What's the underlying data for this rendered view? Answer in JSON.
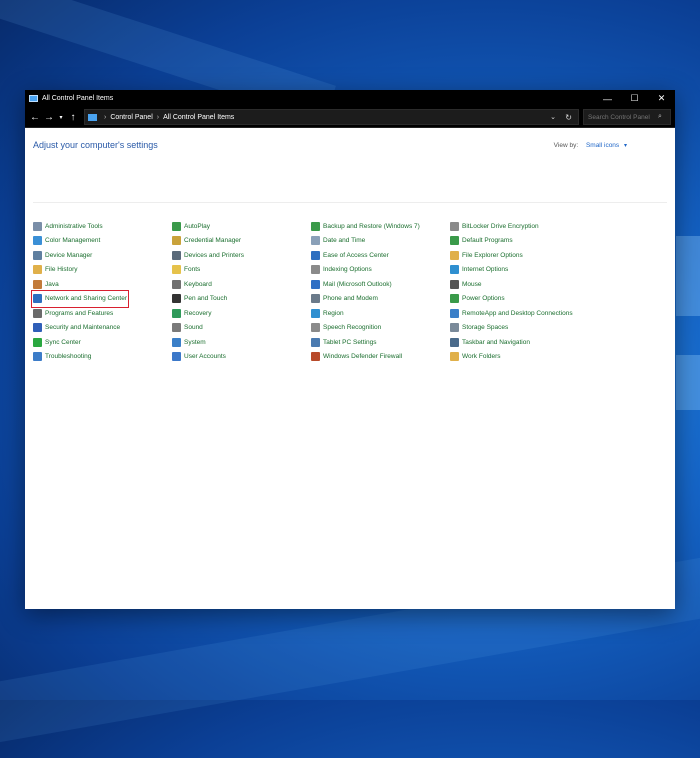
{
  "window": {
    "title": "All Control Panel Items",
    "controls": {
      "minimize": "—",
      "maximize": "☐",
      "close": "✕"
    }
  },
  "address": {
    "back": "←",
    "forward": "→",
    "recent": "▾",
    "up": "↑",
    "breadcrumbs": [
      "Control Panel",
      "All Control Panel Items"
    ],
    "dropdown": "⌄",
    "refresh": "↻",
    "search_placeholder": "Search Control Panel",
    "search_icon": "⌕"
  },
  "main": {
    "heading": "Adjust your computer's settings",
    "view_by_label": "View by:",
    "view_by_value": "Small icons",
    "view_by_caret": "▾"
  },
  "items": [
    [
      {
        "label": "Administrative Tools",
        "icon": "admin-tools-icon",
        "color": "#7a8ea8"
      },
      {
        "label": "Color Management",
        "icon": "color-management-icon",
        "color": "#3a8fd6"
      },
      {
        "label": "Device Manager",
        "icon": "device-manager-icon",
        "color": "#5f7fa0"
      },
      {
        "label": "File History",
        "icon": "file-history-icon",
        "color": "#e0b04a"
      },
      {
        "label": "Java",
        "icon": "java-icon",
        "color": "#c27b3a"
      },
      {
        "label": "Network and Sharing Center",
        "icon": "network-icon",
        "color": "#2e6fc0",
        "selected": true
      },
      {
        "label": "Programs and Features",
        "icon": "programs-icon",
        "color": "#6a6a6a"
      },
      {
        "label": "Security and Maintenance",
        "icon": "security-flag-icon",
        "color": "#2f5fb8"
      },
      {
        "label": "Sync Center",
        "icon": "sync-icon",
        "color": "#2aa840"
      },
      {
        "label": "Troubleshooting",
        "icon": "troubleshoot-icon",
        "color": "#3c7cc8"
      }
    ],
    [
      {
        "label": "AutoPlay",
        "icon": "autoplay-icon",
        "color": "#3a9a4a"
      },
      {
        "label": "Credential Manager",
        "icon": "credential-icon",
        "color": "#c9a23a"
      },
      {
        "label": "Devices and Printers",
        "icon": "printer-icon",
        "color": "#5a6a7a"
      },
      {
        "label": "Fonts",
        "icon": "fonts-icon",
        "color": "#e6c24a"
      },
      {
        "label": "Keyboard",
        "icon": "keyboard-icon",
        "color": "#707070"
      },
      {
        "label": "Pen and Touch",
        "icon": "pen-icon",
        "color": "#333333"
      },
      {
        "label": "Recovery",
        "icon": "recovery-icon",
        "color": "#2f9a5a"
      },
      {
        "label": "Sound",
        "icon": "sound-icon",
        "color": "#7a7a7a"
      },
      {
        "label": "System",
        "icon": "system-icon",
        "color": "#3a7fc8"
      },
      {
        "label": "User Accounts",
        "icon": "user-accounts-icon",
        "color": "#3b78c9"
      }
    ],
    [
      {
        "label": "Backup and Restore (Windows 7)",
        "icon": "backup-icon",
        "color": "#3a9a4a"
      },
      {
        "label": "Date and Time",
        "icon": "clock-icon",
        "color": "#8aa0b8"
      },
      {
        "label": "Ease of Access Center",
        "icon": "ease-access-icon",
        "color": "#2e6fc0"
      },
      {
        "label": "Indexing Options",
        "icon": "indexing-icon",
        "color": "#8a8a8a"
      },
      {
        "label": "Mail (Microsoft Outlook)",
        "icon": "mail-icon",
        "color": "#2f6fc4"
      },
      {
        "label": "Phone and Modem",
        "icon": "phone-icon",
        "color": "#6a7a8a"
      },
      {
        "label": "Region",
        "icon": "region-icon",
        "color": "#2f8fd0"
      },
      {
        "label": "Speech Recognition",
        "icon": "microphone-icon",
        "color": "#8a8a8a"
      },
      {
        "label": "Tablet PC Settings",
        "icon": "tablet-icon",
        "color": "#4a7ab0"
      },
      {
        "label": "Windows Defender Firewall",
        "icon": "firewall-icon",
        "color": "#b84a2a"
      }
    ],
    [
      {
        "label": "BitLocker Drive Encryption",
        "icon": "bitlocker-icon",
        "color": "#8a8a8a"
      },
      {
        "label": "Default Programs",
        "icon": "default-programs-icon",
        "color": "#3a9a4a"
      },
      {
        "label": "File Explorer Options",
        "icon": "folder-options-icon",
        "color": "#e0b04a"
      },
      {
        "label": "Internet Options",
        "icon": "internet-icon",
        "color": "#2f8fd0"
      },
      {
        "label": "Mouse",
        "icon": "mouse-icon",
        "color": "#555555"
      },
      {
        "label": "Power Options",
        "icon": "power-icon",
        "color": "#3a9a4a"
      },
      {
        "label": "RemoteApp and Desktop Connections",
        "icon": "remote-icon",
        "color": "#3a7fc8"
      },
      {
        "label": "Storage Spaces",
        "icon": "storage-icon",
        "color": "#7a8a9a"
      },
      {
        "label": "Taskbar and Navigation",
        "icon": "taskbar-icon",
        "color": "#4a6a8a"
      },
      {
        "label": "Work Folders",
        "icon": "work-folders-icon",
        "color": "#e0b04a"
      }
    ]
  ]
}
